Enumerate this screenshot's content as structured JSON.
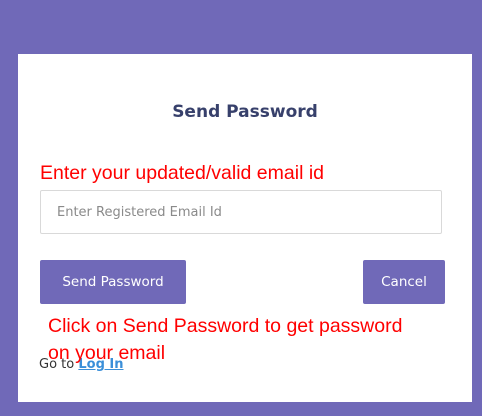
{
  "dialog": {
    "title": "Send Password",
    "email_placeholder": "Enter Registered Email Id",
    "email_value": "",
    "send_label": "Send Password",
    "cancel_label": "Cancel",
    "goto_prefix": "Go to",
    "login_link_label": "Log In"
  },
  "annotations": {
    "email_note": "Enter your updated/valid email id",
    "send_note_line1": "Click on Send Password to get password",
    "send_note_line2": "on your email"
  },
  "colors": {
    "background": "#7069b8",
    "button": "#7069b8",
    "title": "#37406b",
    "annotation": "#ff0000",
    "link": "#3a8fd9"
  }
}
